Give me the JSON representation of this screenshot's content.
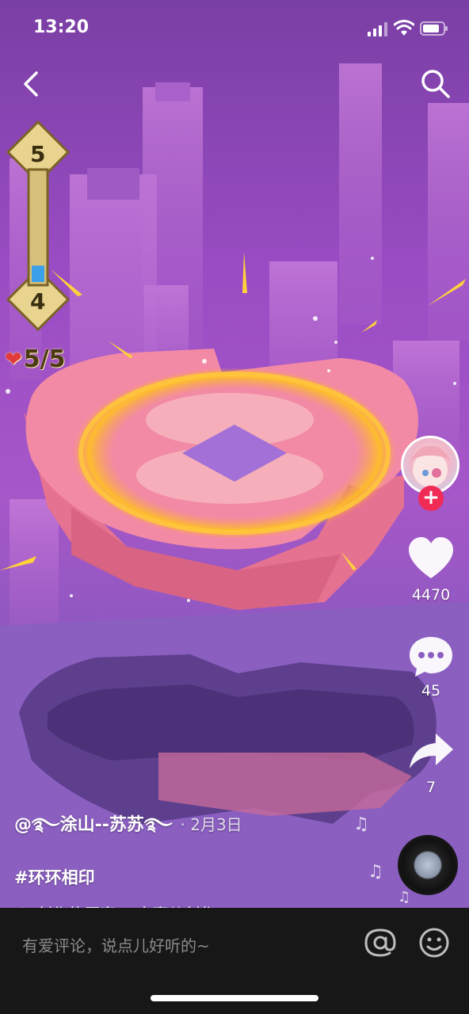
{
  "status_bar": {
    "time": "13:20"
  },
  "game": {
    "level_top": "5",
    "level_bottom": "4",
    "level_progress": 0.15,
    "lives": "5/5"
  },
  "actions": {
    "likes": "4470",
    "comments": "45",
    "shares": "7",
    "follow_symbol": "+"
  },
  "caption": {
    "author": "@࿐涂山--苏苏࿐",
    "date": "· 2月3日",
    "hashtag": "#环环相印",
    "music": "创作的原声    @宋嘉儿创作"
  },
  "comment_bar": {
    "placeholder": "有爱评论，说点儿好听的~"
  },
  "icons": {
    "back": "back-chevron-icon",
    "search": "search-icon",
    "like": "heart-icon",
    "comment": "comment-bubble-icon",
    "share": "share-arrow-icon",
    "at": "at-icon",
    "emoji": "smiley-icon",
    "music_note": "music-note-icon"
  }
}
